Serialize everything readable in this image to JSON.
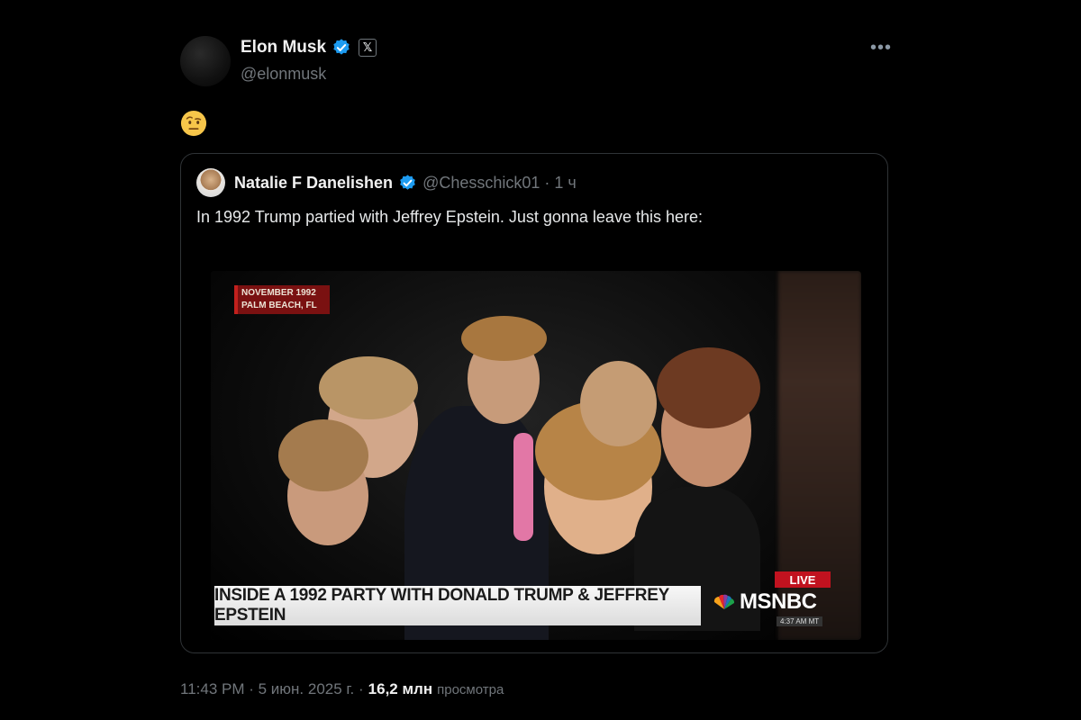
{
  "author": {
    "name": "Elon Musk",
    "handle": "@elonmusk",
    "affiliate_badge": "𝕏"
  },
  "tweet": {
    "emoji": "face-with-raised-eyebrow"
  },
  "quoted": {
    "name": "Natalie F Danelishen",
    "meta": "@Chesschick01 · 1 ч",
    "text": "In 1992 Trump partied with Jeffrey Epstein. Just gonna leave this here:",
    "video": {
      "date_tag_line1": "NOVEMBER 1992",
      "date_tag_line2": "PALM BEACH, FL",
      "headline": "INSIDE A 1992 PARTY WITH DONALD TRUMP & JEFFREY EPSTEIN",
      "live": "LIVE",
      "network": "MSNBC",
      "clock": "4:37 AM MT"
    }
  },
  "footer": {
    "time": "11:43 PM · 5 июн. 2025 г. ·",
    "views_count": "16,2 млн",
    "views_label": "просмотра"
  },
  "colors": {
    "background": "#000000",
    "verified_blue": "#1d9bf0",
    "muted_text": "#71767b",
    "live_red": "#c1121f"
  }
}
